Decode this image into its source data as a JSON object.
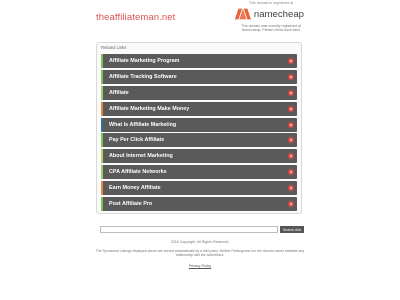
{
  "header": {
    "domain": "theaffiliateman.net"
  },
  "registrar": {
    "notice": "This domain is registered at",
    "logo_text": "namecheap",
    "description_line1": "This domain was recently registered at",
    "description_line2": "Namecheap. Please check back later!"
  },
  "related": {
    "title": "Related Links",
    "links": [
      {
        "label": "Affiliate Marketing Program",
        "stripe": "#7fbf4f"
      },
      {
        "label": "Affiliate Tracking Software",
        "stripe": "#7fbf4f"
      },
      {
        "label": "Affiliate",
        "stripe": "#9ccc65"
      },
      {
        "label": "Affiliate Marketing Make Money",
        "stripe": "#e8863a"
      },
      {
        "label": "What Is Affiliate Marketing",
        "stripe": "#2e6f9e"
      },
      {
        "label": "Pay Per Click Affiliate",
        "stripe": "#7fbf4f"
      },
      {
        "label": "About Internet Marketing",
        "stripe": "#b5d65c"
      },
      {
        "label": "CPA Affiliate Networks",
        "stripe": "#9ccc65"
      },
      {
        "label": "Earn Money Affiliate",
        "stripe": "#e8863a"
      },
      {
        "label": "Post Affiliate Pro",
        "stripe": "#7fbf4f"
      }
    ],
    "arrow_color": "#e0493f",
    "arrow_icon": "play-circle-icon"
  },
  "search": {
    "value": "",
    "button_label": "Search Ads"
  },
  "footer": {
    "copyright": "2016 Copyright. All Rights Reserved.",
    "disclaimer_line1": "The Sponsored Listings displayed above are served automatically by a third party. Neither Parkingcrew nor the domain owner maintain any",
    "disclaimer_line2": "relationship with the advertisers.",
    "privacy_label": "Privacy Policy"
  }
}
